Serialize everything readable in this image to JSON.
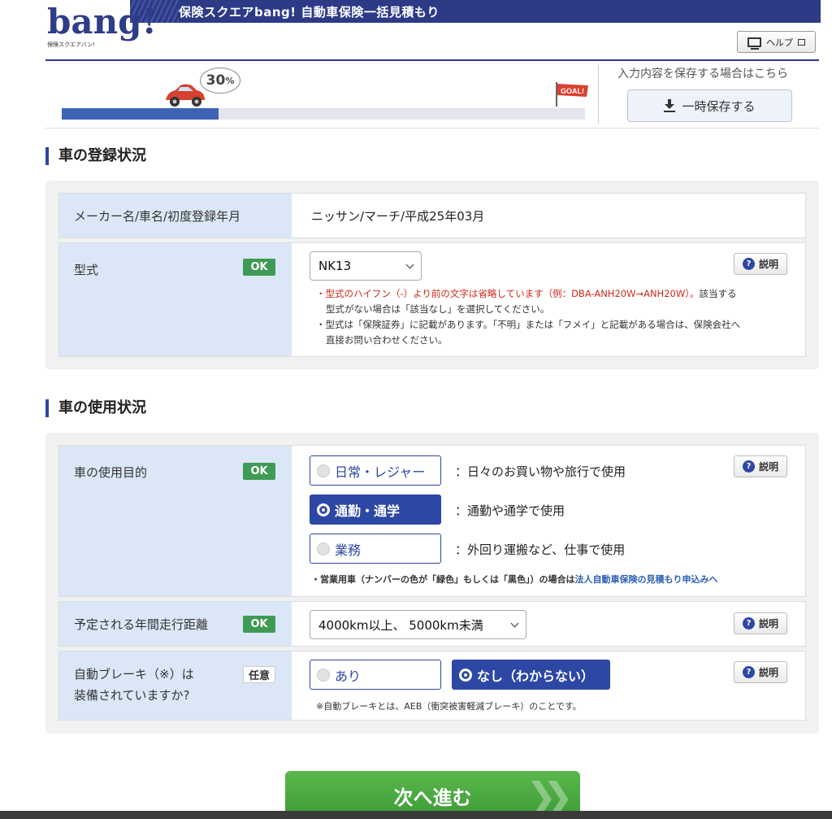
{
  "header": {
    "site_title": "保険スクエアbang! 自動車保険一括見積もり",
    "logo_text": "bang!",
    "logo_sub": "保険スクエアバン!",
    "help_label": "ヘルプ"
  },
  "progress": {
    "percent": 30,
    "percent_label": "30",
    "percent_unit": "%",
    "goal_label": "GOAL!"
  },
  "save": {
    "prompt": "入力内容を保存する場合はこちら",
    "button_label": "一時保存する"
  },
  "section1": {
    "title": "車の登録状況",
    "row1": {
      "label": "メーカー名/車名/初度登録年月",
      "value": "ニッサン/マーチ/平成25年03月"
    },
    "row2": {
      "label": "型式",
      "badge": "OK",
      "select_value": "NK13",
      "explain_label": "説明",
      "note1_red": "・型式のハイフン（-）より前の文字は省略しています（例：DBA-ANH20W→ANH20W）。",
      "note1_rest": "該当する",
      "note1_line2": "型式がない場合は「該当なし」を選択してください。",
      "note2_line1": "・型式は「保険証券」に記載があります。「不明」または「フメイ」と記載がある場合は、保険会社へ",
      "note2_line2": "直接お問い合わせください。"
    }
  },
  "section2": {
    "title": "車の使用状況",
    "purpose": {
      "label": "車の使用目的",
      "badge": "OK",
      "explain_label": "説明",
      "options": [
        {
          "label": "日常・レジャー",
          "desc": "：日々のお買い物や旅行で使用",
          "selected": false
        },
        {
          "label": "通勤・通学",
          "desc": "：通勤や通学で使用",
          "selected": true
        },
        {
          "label": "業務",
          "desc": "：外回り運搬など、仕事で使用",
          "selected": false
        }
      ],
      "note_text": "・営業用車（ナンバーの色が「緑色」もしくは「黒色」）の場合は",
      "note_link": "法人自動車保険の見積もり申込みへ"
    },
    "mileage": {
      "label": "予定される年間走行距離",
      "badge": "OK",
      "select_value": "4000km以上、 5000km未満",
      "explain_label": "説明"
    },
    "brake": {
      "label_line1": "自動ブレーキ（※）は",
      "label_line2": "装備されていますか?",
      "badge": "任意",
      "explain_label": "説明",
      "options": [
        {
          "label": "あり",
          "selected": false
        },
        {
          "label": "なし（わからない）",
          "selected": true
        }
      ],
      "note": "※自動ブレーキとは、AEB（衝突被害軽減ブレーキ）のことです。"
    }
  },
  "footer": {
    "next_label": "次へ進む"
  },
  "colors": {
    "brand_navy": "#2d3a86",
    "selected_blue": "#2d47a5",
    "ok_green": "#3f9a55",
    "next_green": "#4caf43"
  }
}
